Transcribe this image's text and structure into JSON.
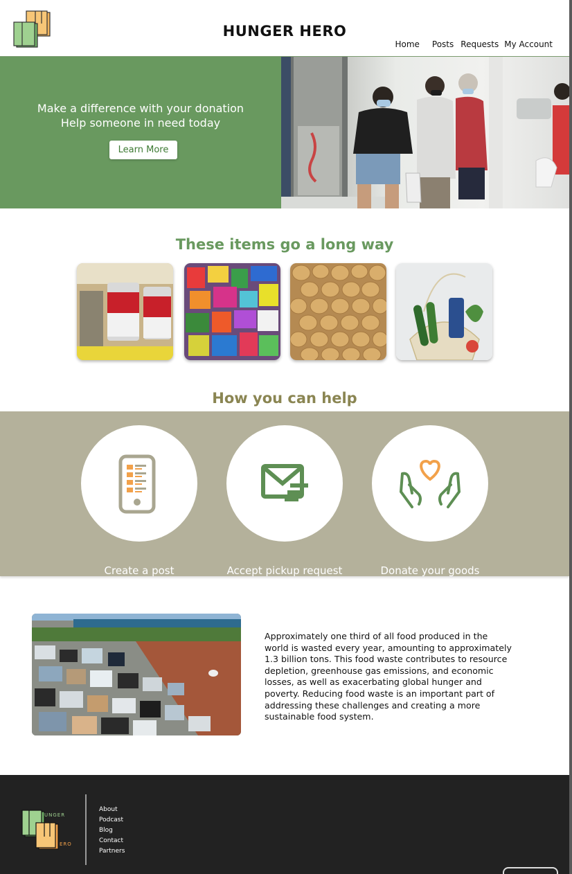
{
  "header": {
    "site_title": "HUNGER HERO",
    "nav": {
      "home": "Home",
      "posts": "Posts",
      "requests": "Requests",
      "account": "My Account"
    }
  },
  "hero": {
    "line1": "Make a difference with your donation",
    "line2": "Help someone in need today",
    "button_label": "Learn More",
    "background_color": "#69995f"
  },
  "items": {
    "title": "These items go a long way",
    "tiles": [
      {
        "icon": "canned-food-photo"
      },
      {
        "icon": "snacks-photo"
      },
      {
        "icon": "potatoes-photo"
      },
      {
        "icon": "grocery-bag-photo"
      }
    ]
  },
  "help": {
    "title": "How you can help",
    "band_color": "#b4b19b",
    "cards": [
      {
        "label": "Create a post",
        "icon": "phone-list-icon"
      },
      {
        "label": "Accept pickup request",
        "icon": "mail-icon"
      },
      {
        "label": "Donate your goods",
        "icon": "hands-heart-icon"
      }
    ]
  },
  "info": {
    "paragraph": "Approximately one third of all food produced in the world is wasted every year, amounting to approximately 1.3 billion tons. This food waste contributes to resource depletion, greenhouse gas emissions, and economic losses, as well as exacerbating global hunger and poverty. Reducing food waste is an important part of addressing these challenges and creating a more sustainable food system."
  },
  "footer": {
    "logo_text_top": "UNGER",
    "logo_text_bottom": "ERO",
    "links": [
      "About",
      "Podcast",
      "Blog",
      "Contact",
      "Partners"
    ]
  }
}
